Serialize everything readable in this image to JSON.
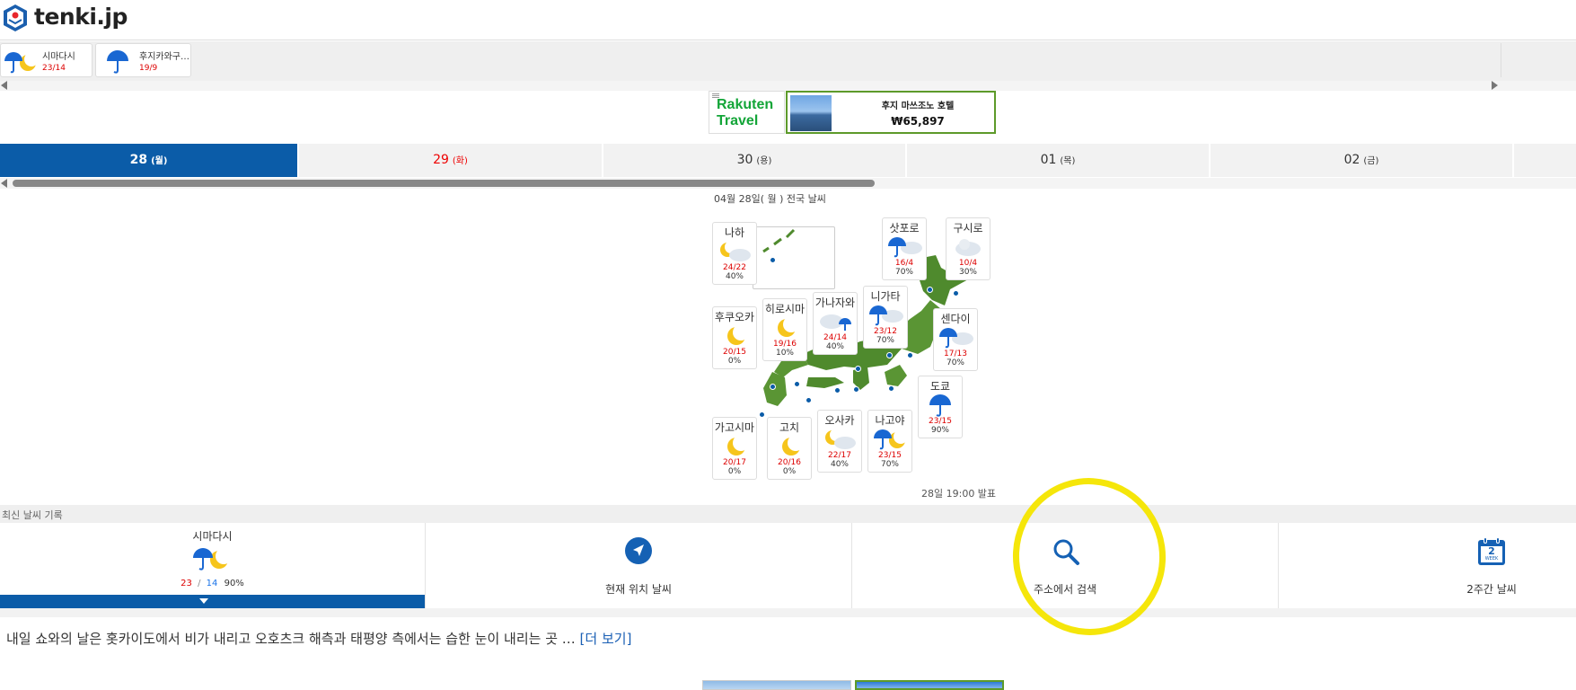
{
  "header": {
    "logo_text": "tenki.jp",
    "logo_icon": "tenki-logo-icon"
  },
  "recent_cities": [
    {
      "name": "시마다시",
      "temp": "23/14",
      "icon": "umbrella-moon-icon"
    },
    {
      "name": "후지카와구…",
      "temp": "19/9",
      "icon": "umbrella-icon"
    }
  ],
  "ad": {
    "brand": "Rakuten Travel",
    "hotel": "후지 마쓰조노 호텔",
    "price": "₩65,897"
  },
  "date_tabs": [
    {
      "day": "28",
      "weekday": "(월)",
      "state": "active"
    },
    {
      "day": "29",
      "weekday": "(화)",
      "state": "holiday"
    },
    {
      "day": "30",
      "weekday": "(용)",
      "state": "normal"
    },
    {
      "day": "01",
      "weekday": "(목)",
      "state": "normal"
    },
    {
      "day": "02",
      "weekday": "(금)",
      "state": "normal"
    }
  ],
  "map": {
    "title": "04월 28일( 월 ) 전국 날씨",
    "announce": "28일 19:00 발표",
    "cities": [
      {
        "name": "나하",
        "temp": "24/22",
        "pop": "40%",
        "icon": "moon-cloud-icon"
      },
      {
        "name": "삿포로",
        "temp": "16/4",
        "pop": "70%",
        "icon": "umbrella-cloud-icon"
      },
      {
        "name": "구시로",
        "temp": "10/4",
        "pop": "30%",
        "icon": "cloud-icon"
      },
      {
        "name": "후쿠오카",
        "temp": "20/15",
        "pop": "0%",
        "icon": "moon-icon"
      },
      {
        "name": "히로시마",
        "temp": "19/16",
        "pop": "10%",
        "icon": "moon-icon"
      },
      {
        "name": "가나자와",
        "temp": "24/14",
        "pop": "40%",
        "icon": "cloud-umbrella-icon"
      },
      {
        "name": "니가타",
        "temp": "23/12",
        "pop": "70%",
        "icon": "umbrella-cloud-icon"
      },
      {
        "name": "센다이",
        "temp": "17/13",
        "pop": "70%",
        "icon": "umbrella-cloud-icon"
      },
      {
        "name": "도쿄",
        "temp": "23/15",
        "pop": "90%",
        "icon": "umbrella-icon"
      },
      {
        "name": "가고시마",
        "temp": "20/17",
        "pop": "0%",
        "icon": "moon-icon"
      },
      {
        "name": "고치",
        "temp": "20/16",
        "pop": "0%",
        "icon": "moon-icon"
      },
      {
        "name": "오사카",
        "temp": "22/17",
        "pop": "40%",
        "icon": "moon-cloud-icon"
      },
      {
        "name": "나고야",
        "temp": "23/15",
        "pop": "70%",
        "icon": "umbrella-moon-icon"
      }
    ]
  },
  "recent_record": {
    "label": "최신 날씨 기록",
    "current_city": {
      "name": "시마다시",
      "high": "23",
      "sep": "/",
      "low": "14",
      "pop": "90%"
    },
    "nav": [
      {
        "label": "현재 위치 날씨",
        "icon": "location-arrow-icon"
      },
      {
        "label": "주소에서 검색",
        "icon": "search-icon"
      },
      {
        "label": "2주간 날씨",
        "icon": "calendar-2week-icon"
      }
    ],
    "calendar_icon_text": "2",
    "calendar_icon_sub": "WEEK"
  },
  "summary": {
    "text": "내일 쇼와의 날은 홋카이도에서 비가 내리고 오호츠크 해측과 태평양 측에서는 습한 눈이 내리는 곳 …",
    "more": "[더 보기]"
  },
  "colors": {
    "brand_blue": "#0b5ca8",
    "holiday_red": "#e00000",
    "highlight_yellow": "#f5e60a"
  }
}
